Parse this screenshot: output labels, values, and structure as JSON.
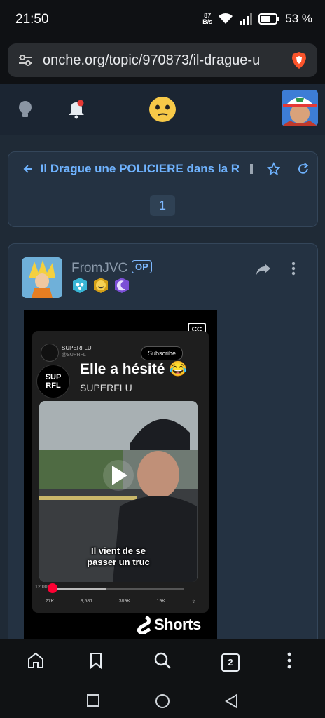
{
  "status": {
    "time": "21:50",
    "speed_top": "87",
    "speed_bottom": "B/s",
    "battery": "53 %"
  },
  "browser": {
    "url": "onche.org/topic/970873/il-drague-u"
  },
  "topic": {
    "title": "Il Drague une POLICIERE dans la R",
    "page": "1"
  },
  "post": {
    "author": "FromJVC",
    "op_label": "OP",
    "video": {
      "account_name": "SUPERFLU",
      "account_handle": "@SUPRFL",
      "subscribe": "Subscribe",
      "title": "Elle a hésité 😂",
      "channel": "SUPERFLU",
      "avatar_text": "SUP RFL",
      "caption_line1": "Il vient de se",
      "caption_line2": "passer un truc",
      "cc": "CC",
      "tweet_time": "12:00",
      "stats": [
        "27K",
        "8,581",
        "389K",
        "19K"
      ],
      "shorts": "Shorts"
    }
  },
  "bottom": {
    "tabs_count": "2"
  }
}
